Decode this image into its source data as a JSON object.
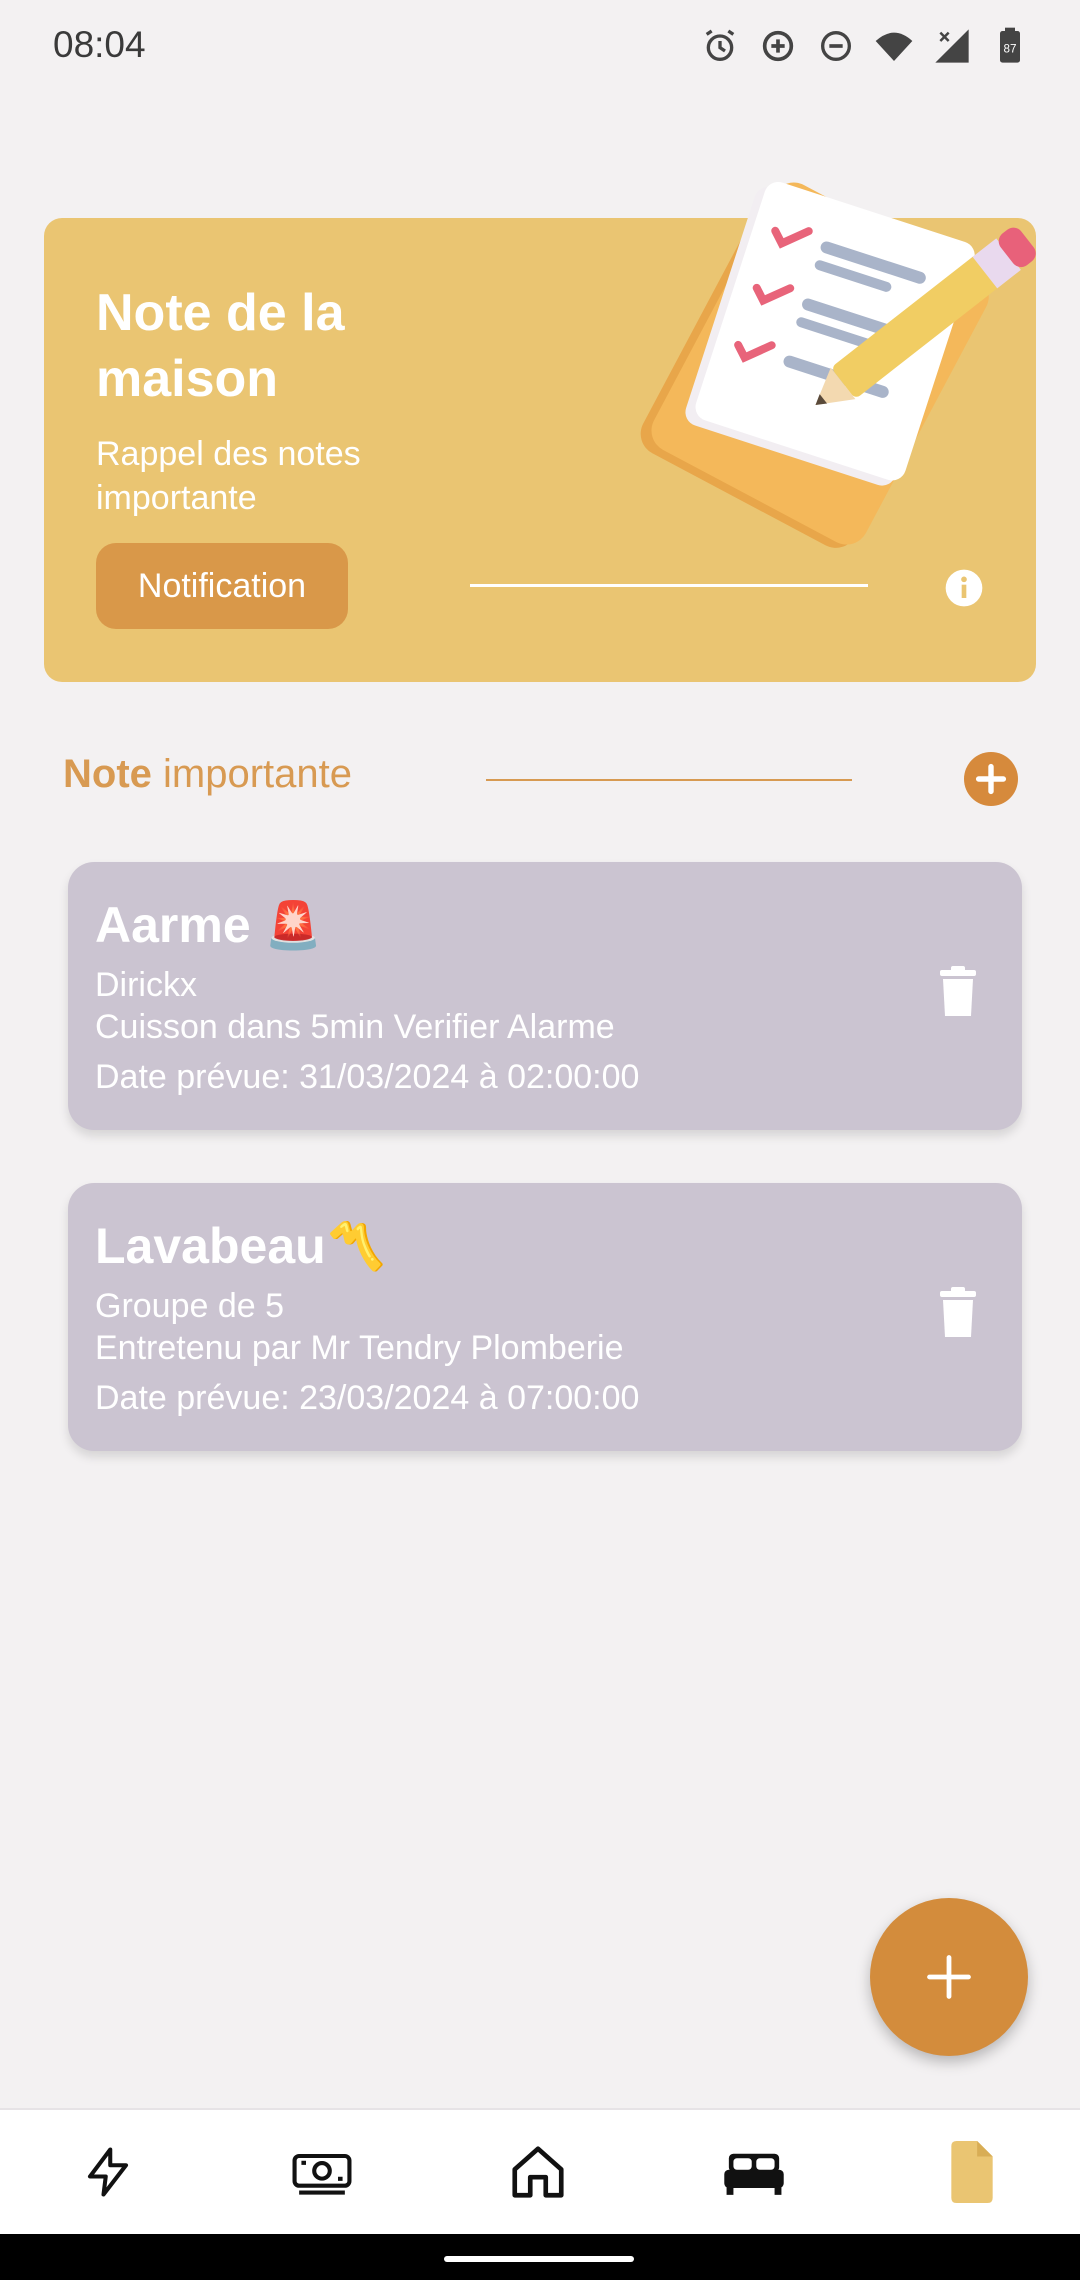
{
  "status_bar": {
    "time": "08:04",
    "battery": "87",
    "icons": [
      "alarm-icon",
      "data-saver-icon",
      "dnd-icon",
      "wifi-icon",
      "signal-icon",
      "battery-icon"
    ]
  },
  "hero": {
    "title": "Note de la maison",
    "subtitle": "Rappel des notes importante",
    "button_label": "Notification",
    "bg_color": "#eac572",
    "button_color": "#d99849"
  },
  "section": {
    "title_bold": "Note",
    "title_rest": " importante",
    "accent_color": "#d89a52"
  },
  "notes": [
    {
      "title": "Aarme",
      "emoji": "🚨",
      "line1": "Dirickx",
      "line2": "Cuisson dans 5min Verifier Alarme",
      "line3": "Date prévue: 31/03/2024 à 02:00:00"
    },
    {
      "title": "Lavabeau",
      "emoji": "〽️",
      "line1": "Groupe de 5",
      "line2": "Entretenu par Mr Tendry Plomberie",
      "line3": "Date prévue: 23/03/2024 à 07:00:00"
    }
  ],
  "bottom_nav": {
    "items": [
      "lightning-icon",
      "money-icon",
      "home-icon",
      "bed-icon",
      "document-icon"
    ],
    "active": "document-icon",
    "active_color": "#eac572"
  }
}
